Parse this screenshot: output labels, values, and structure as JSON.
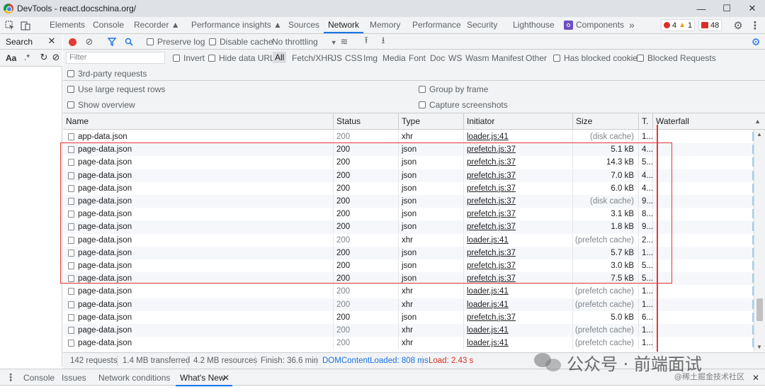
{
  "window": {
    "title": "DevTools - react.docschina.org/",
    "minimize": "—",
    "maximize": "☐",
    "close": "✕"
  },
  "main_tabs": [
    {
      "label": "Elements"
    },
    {
      "label": "Console"
    },
    {
      "label": "Recorder ▲"
    },
    {
      "label": "Performance insights ▲"
    },
    {
      "label": "Sources"
    },
    {
      "label": "Network"
    },
    {
      "label": "Memory"
    },
    {
      "label": "Performance"
    },
    {
      "label": "Security"
    },
    {
      "label": "Lighthouse"
    },
    {
      "label": "Components"
    }
  ],
  "more_tabs": "»",
  "counters": {
    "errors": "4",
    "warnings": "1",
    "issues": "48"
  },
  "left_panel": {
    "search_label": "Search",
    "aa": "Aa",
    "regex": ".*"
  },
  "toolbar": {
    "preserve_log": "Preserve log",
    "disable_cache": "Disable cache",
    "throttling": "No throttling"
  },
  "filter": {
    "placeholder": "Filter",
    "invert": "Invert",
    "hide_data_urls": "Hide data URLs",
    "types": [
      "All",
      "Fetch/XHR",
      "JS",
      "CSS",
      "Img",
      "Media",
      "Font",
      "Doc",
      "WS",
      "Wasm",
      "Manifest",
      "Other"
    ],
    "has_blocked_cookies": "Has blocked cookies",
    "blocked_requests": "Blocked Requests",
    "third_party": "3rd-party requests"
  },
  "settings": {
    "large_rows": "Use large request rows",
    "show_overview": "Show overview",
    "group_by_frame": "Group by frame",
    "capture_screenshots": "Capture screenshots"
  },
  "table": {
    "headers": {
      "name": "Name",
      "status": "Status",
      "type": "Type",
      "initiator": "Initiator",
      "size": "Size",
      "time": "T.",
      "waterfall": "Waterfall"
    },
    "rows": [
      {
        "name": "app-data.json",
        "status": "200",
        "type": "xhr",
        "initiator": "loader.js:41",
        "size": "(disk cache)",
        "time": "1..."
      },
      {
        "name": "page-data.json",
        "status": "200",
        "type": "json",
        "initiator": "prefetch.js:37",
        "size": "5.1 kB",
        "time": "4..."
      },
      {
        "name": "page-data.json",
        "status": "200",
        "type": "json",
        "initiator": "prefetch.js:37",
        "size": "14.3 kB",
        "time": "5..."
      },
      {
        "name": "page-data.json",
        "status": "200",
        "type": "json",
        "initiator": "prefetch.js:37",
        "size": "7.0 kB",
        "time": "4..."
      },
      {
        "name": "page-data.json",
        "status": "200",
        "type": "json",
        "initiator": "prefetch.js:37",
        "size": "6.0 kB",
        "time": "4..."
      },
      {
        "name": "page-data.json",
        "status": "200",
        "type": "json",
        "initiator": "prefetch.js:37",
        "size": "(disk cache)",
        "time": "9..."
      },
      {
        "name": "page-data.json",
        "status": "200",
        "type": "json",
        "initiator": "prefetch.js:37",
        "size": "3.1 kB",
        "time": "8..."
      },
      {
        "name": "page-data.json",
        "status": "200",
        "type": "json",
        "initiator": "prefetch.js:37",
        "size": "1.8 kB",
        "time": "9..."
      },
      {
        "name": "page-data.json",
        "status": "200",
        "type": "xhr",
        "initiator": "loader.js:41",
        "size": "(prefetch cache)",
        "time": "2..."
      },
      {
        "name": "page-data.json",
        "status": "200",
        "type": "json",
        "initiator": "prefetch.js:37",
        "size": "5.7 kB",
        "time": "1..."
      },
      {
        "name": "page-data.json",
        "status": "200",
        "type": "json",
        "initiator": "prefetch.js:37",
        "size": "3.0 kB",
        "time": "5..."
      },
      {
        "name": "page-data.json",
        "status": "200",
        "type": "json",
        "initiator": "prefetch.js:37",
        "size": "7.5 kB",
        "time": "5..."
      },
      {
        "name": "page-data.json",
        "status": "200",
        "type": "xhr",
        "initiator": "loader.js:41",
        "size": "(prefetch cache)",
        "time": "1..."
      },
      {
        "name": "page-data.json",
        "status": "200",
        "type": "xhr",
        "initiator": "loader.js:41",
        "size": "(prefetch cache)",
        "time": "1..."
      },
      {
        "name": "page-data.json",
        "status": "200",
        "type": "json",
        "initiator": "prefetch.js:37",
        "size": "5.0 kB",
        "time": "6..."
      },
      {
        "name": "page-data.json",
        "status": "200",
        "type": "xhr",
        "initiator": "loader.js:41",
        "size": "(prefetch cache)",
        "time": "1..."
      },
      {
        "name": "page-data.json",
        "status": "200",
        "type": "xhr",
        "initiator": "loader.js:41",
        "size": "(prefetch cache)",
        "time": "1..."
      }
    ]
  },
  "status": {
    "requests": "142 requests",
    "transferred": "1.4 MB transferred",
    "resources": "4.2 MB resources",
    "finish": "Finish: 36.6 min",
    "dom": "DOMContentLoaded: 808 ms",
    "load": "Load: 2.43 s"
  },
  "drawer": {
    "tabs": [
      "Console",
      "Issues",
      "Network conditions",
      "What's New"
    ],
    "close": "✕"
  },
  "watermark": {
    "main": "公众号 · 前端面试",
    "sub": "@稀土掘金技术社区"
  },
  "colors": {
    "accent": "#1a73e8",
    "record": "#e53935",
    "annotation": "#e53935"
  }
}
